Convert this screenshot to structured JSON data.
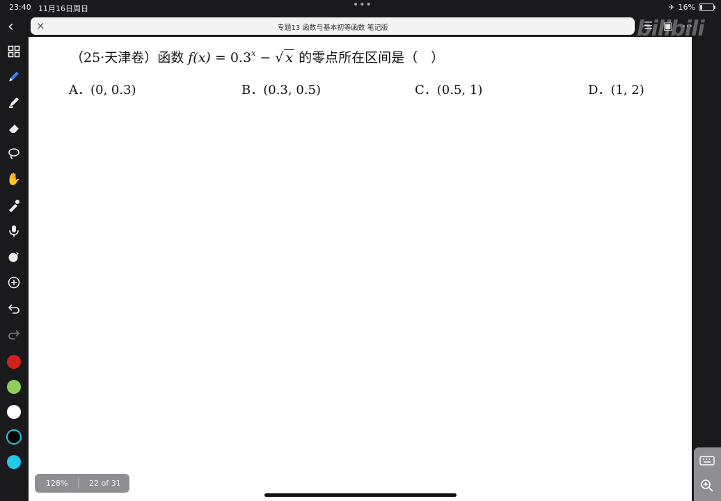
{
  "status": {
    "time": "23:40",
    "date": "11月16日周日",
    "battery": "16%",
    "battery_level": 0.16
  },
  "tab": {
    "title": "专题13 函数与基本初等函数 笔记版",
    "close_icon": "×"
  },
  "watermark": "bilibili",
  "question": {
    "prefix": "（25·天津卷）函数",
    "fx": "f(x)",
    "eq": " = 0.3",
    "exp": "x",
    "minus": " − ",
    "radicand": "x",
    "suffix": "的零点所在区间是（　）"
  },
  "choices": [
    {
      "letter": "A．",
      "value": "(0, 0.3)"
    },
    {
      "letter": "B．",
      "value": "(0.3, 0.5)"
    },
    {
      "letter": "C．",
      "value": "(0.5, 1)"
    },
    {
      "letter": "D．",
      "value": "(1, 2)"
    }
  ],
  "toolbar": {
    "colors": [
      "#d0211c",
      "#8fce5c",
      "#ffffff",
      "#000000",
      "#22c8e8"
    ]
  },
  "footer": {
    "zoom": "128%",
    "pages": "22 of 31"
  }
}
